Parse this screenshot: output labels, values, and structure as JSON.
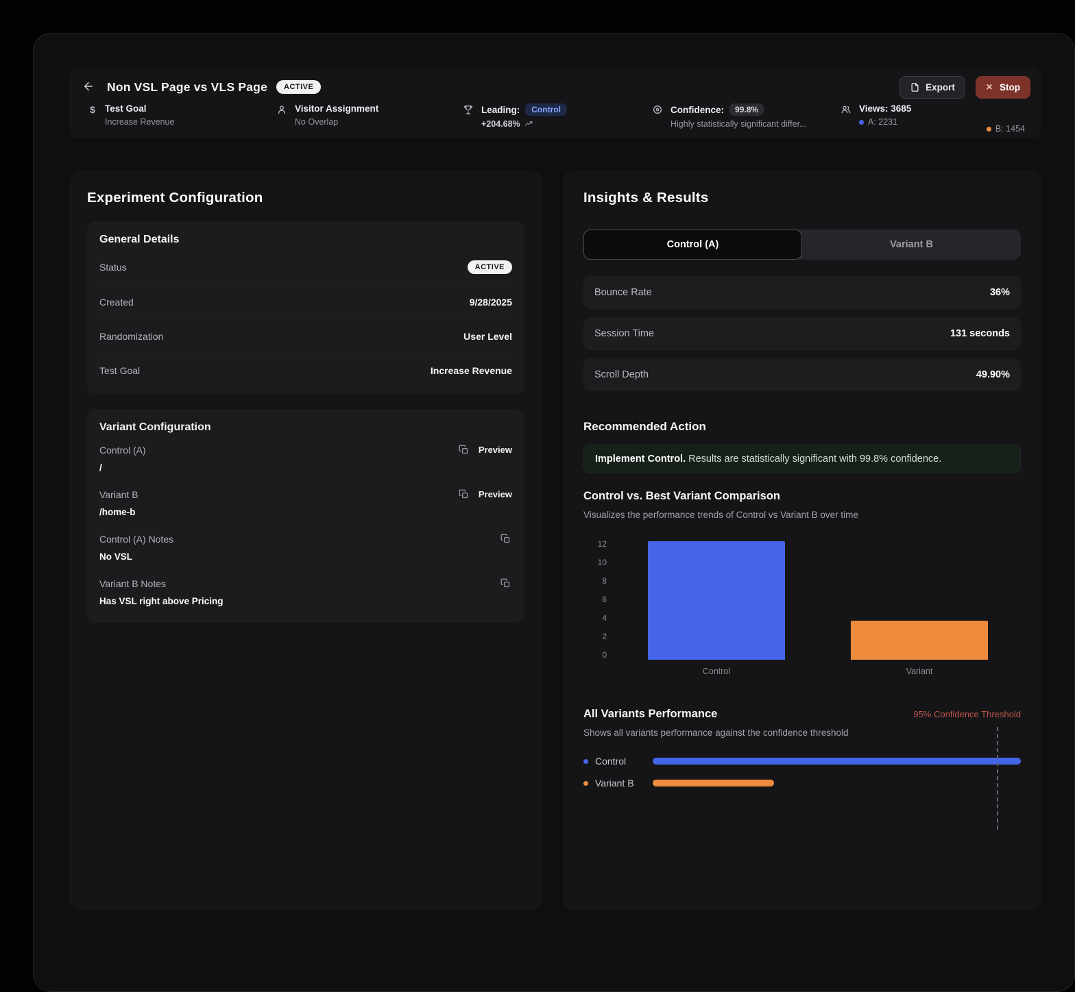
{
  "header": {
    "title": "Non VSL Page vs VLS Page",
    "status_badge": "ACTIVE",
    "export_label": "Export",
    "stop_label": "Stop",
    "goal": {
      "label": "Test Goal",
      "value": "Increase Revenue"
    },
    "assignment": {
      "label": "Visitor Assignment",
      "value": "No Overlap"
    },
    "leading": {
      "label": "Leading:",
      "badge": "Control",
      "delta": "+204.68%"
    },
    "confidence": {
      "label": "Confidence:",
      "badge": "99.8%",
      "note": "Highly statistically significant differ..."
    },
    "views": {
      "label": "Views: 3685",
      "a": "A: 2231",
      "b": "B: 1454"
    }
  },
  "config": {
    "title": "Experiment Configuration",
    "general": {
      "title": "General Details",
      "rows": [
        {
          "label": "Status",
          "value": "ACTIVE"
        },
        {
          "label": "Created",
          "value": "9/28/2025"
        },
        {
          "label": "Randomization",
          "value": "User Level"
        },
        {
          "label": "Test Goal",
          "value": "Increase Revenue"
        }
      ]
    },
    "variants": {
      "title": "Variant Configuration",
      "preview_label": "Preview",
      "rows": [
        {
          "label": "Control (A)",
          "value": "/",
          "has_preview": true
        },
        {
          "label": "Variant B",
          "value": "/home-b",
          "has_preview": true
        },
        {
          "label": "Control (A) Notes",
          "value": "No VSL",
          "has_preview": false
        },
        {
          "label": "Variant B Notes",
          "value": "Has VSL right above Pricing",
          "has_preview": false
        }
      ]
    }
  },
  "insights": {
    "title": "Insights & Results",
    "tabs": [
      {
        "label": "Control (A)",
        "active": true
      },
      {
        "label": "Variant B",
        "active": false
      }
    ],
    "metrics": [
      {
        "label": "Bounce Rate",
        "value": "36%"
      },
      {
        "label": "Session Time",
        "value": "131 seconds"
      },
      {
        "label": "Scroll Depth",
        "value": "49.90%"
      }
    ],
    "recommended": {
      "title": "Recommended Action",
      "strong": "Implement Control.",
      "text": "Results are statistically significant with 99.8% confidence."
    },
    "comparison": {
      "title": "Control vs. Best Variant Comparison",
      "subtitle": "Visualizes the performance trends of Control vs Variant B over time"
    },
    "performance": {
      "title": "All Variants Performance",
      "threshold_label": "95% Confidence Threshold",
      "subtitle": "Shows all variants performance against the confidence threshold"
    }
  },
  "chart_data": [
    {
      "type": "bar",
      "title": "Control vs. Best Variant Comparison",
      "categories": [
        "Control",
        "Variant"
      ],
      "values": [
        11.8,
        3.9
      ],
      "ylim": [
        0,
        12
      ],
      "yticks": [
        12,
        10,
        8,
        6,
        4,
        2,
        0
      ],
      "colors": [
        "#4565e8",
        "#ee8b3d"
      ],
      "grid": false,
      "legend_position": "none"
    },
    {
      "type": "bar",
      "orientation": "horizontal",
      "title": "All Variants Performance",
      "categories": [
        "Control",
        "Variant B"
      ],
      "values": [
        100,
        33
      ],
      "xlim": [
        0,
        100
      ],
      "values_note": "relative bar fill percent; no numeric labels shown on chart",
      "threshold": {
        "label": "95% Confidence Threshold",
        "pct": 93.5
      },
      "colors": [
        "#4565e8",
        "#ee8b3d"
      ]
    }
  ],
  "colors": {
    "accent_blue": "#4565e8",
    "accent_orange": "#ee8b3d",
    "threshold_red": "#c0564b",
    "active_badge_bg": "#f2f2f2",
    "stop_button_bg": "#7e332a",
    "banner_green_bg": "#152119"
  }
}
